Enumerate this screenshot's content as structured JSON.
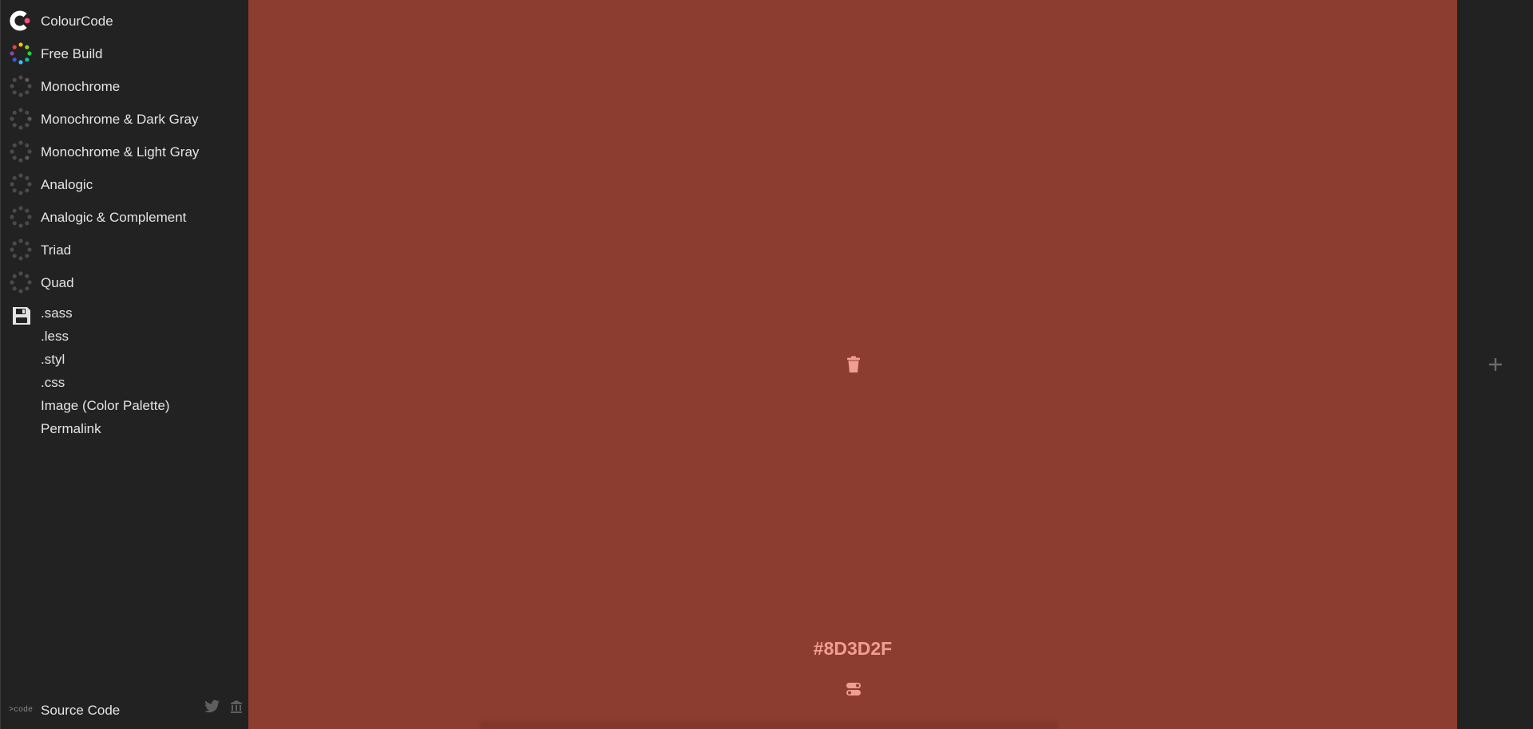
{
  "app": {
    "name": "ColourCode",
    "colors": {
      "sidebar_bg": "#222222",
      "text": "#e4e4e4",
      "accent_pink": "#ff4f7b",
      "swatch": "#8D3D2F",
      "swatch_text": "#f19e91"
    }
  },
  "menu": {
    "items": [
      {
        "label": "ColourCode",
        "icon": "colourcode-logo-icon"
      },
      {
        "label": "Free Build",
        "icon": "color-wheel-icon"
      },
      {
        "label": "Monochrome",
        "icon": "dots-ring-icon"
      },
      {
        "label": "Monochrome & Dark Gray",
        "icon": "dots-ring-icon"
      },
      {
        "label": "Monochrome & Light Gray",
        "icon": "dots-ring-icon"
      },
      {
        "label": "Analogic",
        "icon": "dots-ring-icon"
      },
      {
        "label": "Analogic & Complement",
        "icon": "dots-ring-icon"
      },
      {
        "label": "Triad",
        "icon": "dots-ring-icon"
      },
      {
        "label": "Quad",
        "icon": "dots-ring-icon"
      }
    ]
  },
  "export": {
    "icon": "floppy-disk-icon",
    "items": [
      ".sass",
      ".less",
      ".styl",
      ".css",
      "Image (Color Palette)",
      "Permalink"
    ]
  },
  "footer": {
    "code_icon_text": ">code",
    "source_label": "Source Code",
    "icons": [
      "twitter-icon",
      "bank-icon"
    ]
  },
  "swatch": {
    "hex": "#8D3D2F",
    "icons": [
      "trash-icon",
      "toggle-icon"
    ]
  },
  "add_column": {
    "icon": "plus-icon"
  }
}
